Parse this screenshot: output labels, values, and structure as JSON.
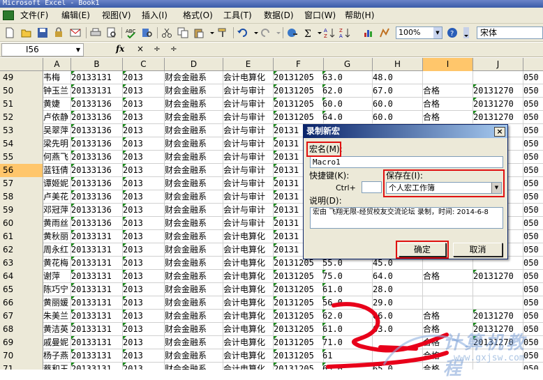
{
  "window": {
    "title": "Microsoft Excel - Book1"
  },
  "menubar": [
    "文件(F)",
    "编辑(E)",
    "视图(V)",
    "插入(I)",
    "格式(O)",
    "工具(T)",
    "数据(D)",
    "窗口(W)",
    "帮助(H)"
  ],
  "toolbar": {
    "zoom": "100%",
    "font": "宋体"
  },
  "formula_bar": {
    "name_box": "I56",
    "fx": "fx",
    "buttons": "× ÷ ÷"
  },
  "columns": [
    "A",
    "B",
    "C",
    "D",
    "E",
    "F",
    "G",
    "H",
    "I",
    "J"
  ],
  "selected_column": "I",
  "selected_row": "56",
  "rows": [
    {
      "n": "49",
      "name": "韦梅",
      "id": "20133131",
      "y": "2013",
      "d": "财会金融系",
      "e": "会计电算化",
      "f": "20131205",
      "g": "63.0",
      "h": "48.0",
      "i": "",
      "j": "",
      "k": "050"
    },
    {
      "n": "50",
      "name": "钟玉兰",
      "id": "20133131",
      "y": "2013",
      "d": "财会金融系",
      "e": "会计与审计",
      "f": "20131205",
      "g": "62.0",
      "h": "67.0",
      "i": "合格",
      "j": "20131270",
      "k": "050"
    },
    {
      "n": "51",
      "name": "黄婕",
      "id": "20133136",
      "y": "2013",
      "d": "财会金融系",
      "e": "会计与审计",
      "f": "20131205",
      "g": "60.0",
      "h": "60.0",
      "i": "合格",
      "j": "20131270",
      "k": "050"
    },
    {
      "n": "52",
      "name": "卢依静",
      "id": "20133136",
      "y": "2013",
      "d": "财会金融系",
      "e": "会计与审计",
      "f": "20131205",
      "g": "64.0",
      "h": "60.0",
      "i": "合格",
      "j": "20131270",
      "k": "050"
    },
    {
      "n": "53",
      "name": "吴翠萍",
      "id": "20133136",
      "y": "2013",
      "d": "财会金融系",
      "e": "会计与审计",
      "f": "20131",
      "g": "",
      "h": "",
      "i": "",
      "j": "",
      "k": "050"
    },
    {
      "n": "54",
      "name": "梁先明",
      "id": "20133136",
      "y": "2013",
      "d": "财会金融系",
      "e": "会计与审计",
      "f": "20131",
      "g": "",
      "h": "",
      "i": "",
      "j": "",
      "k": "050"
    },
    {
      "n": "55",
      "name": "何燕飞",
      "id": "20133136",
      "y": "2013",
      "d": "财会金融系",
      "e": "会计与审计",
      "f": "20131",
      "g": "",
      "h": "",
      "i": "",
      "j": "",
      "k": "050"
    },
    {
      "n": "56",
      "name": "蓝钰倩",
      "id": "20133136",
      "y": "2013",
      "d": "财会金融系",
      "e": "会计与审计",
      "f": "20131",
      "g": "",
      "h": "",
      "i": "",
      "j": "",
      "k": "050"
    },
    {
      "n": "57",
      "name": "谭姬妮",
      "id": "20133136",
      "y": "2013",
      "d": "财会金融系",
      "e": "会计与审计",
      "f": "20131",
      "g": "",
      "h": "",
      "i": "",
      "j": "",
      "k": "050"
    },
    {
      "n": "58",
      "name": "卢美花",
      "id": "20133136",
      "y": "2013",
      "d": "财会金融系",
      "e": "会计与审计",
      "f": "20131",
      "g": "",
      "h": "",
      "i": "",
      "j": "",
      "k": "050"
    },
    {
      "n": "59",
      "name": "邓冠萍",
      "id": "20133136",
      "y": "2013",
      "d": "财会金融系",
      "e": "会计与审计",
      "f": "20131",
      "g": "",
      "h": "",
      "i": "",
      "j": "",
      "k": "050"
    },
    {
      "n": "60",
      "name": "黄雨丝",
      "id": "20133136",
      "y": "2013",
      "d": "财会金融系",
      "e": "会计与审计",
      "f": "20131",
      "g": "",
      "h": "",
      "i": "",
      "j": "",
      "k": "050"
    },
    {
      "n": "61",
      "name": "黄秋丽",
      "id": "20133131",
      "y": "2013",
      "d": "财会金融系",
      "e": "会计电算化",
      "f": "20131",
      "g": "",
      "h": "",
      "i": "",
      "j": "705",
      "k": "050"
    },
    {
      "n": "62",
      "name": "周永红",
      "id": "20133131",
      "y": "2013",
      "d": "财会金融系",
      "e": "会计电算化",
      "f": "20131",
      "g": "",
      "h": "",
      "i": "",
      "j": "705",
      "k": "050"
    },
    {
      "n": "63",
      "name": "黄花梅",
      "id": "20133131",
      "y": "2013",
      "d": "财会金融系",
      "e": "会计电算化",
      "f": "20131205",
      "g": "55.0",
      "h": "45.0",
      "i": "",
      "j": "",
      "k": "050"
    },
    {
      "n": "64",
      "name": "谢萍",
      "id": "20133131",
      "y": "2013",
      "d": "财会金融系",
      "e": "会计电算化",
      "f": "20131205",
      "g": "75.0",
      "h": "64.0",
      "i": "合格",
      "j": "20131270",
      "k": "050"
    },
    {
      "n": "65",
      "name": "陈巧宁",
      "id": "20133131",
      "y": "2013",
      "d": "财会金融系",
      "e": "会计电算化",
      "f": "20131205",
      "g": "61.0",
      "h": "28.0",
      "i": "",
      "j": "",
      "k": "050"
    },
    {
      "n": "66",
      "name": "黄丽媛",
      "id": "20133131",
      "y": "2013",
      "d": "财会金融系",
      "e": "会计电算化",
      "f": "20131205",
      "g": "56.0",
      "h": "29.0",
      "i": "",
      "j": "",
      "k": "050"
    },
    {
      "n": "67",
      "name": "朱美兰",
      "id": "20133131",
      "y": "2013",
      "d": "财会金融系",
      "e": "会计电算化",
      "f": "20131205",
      "g": "62.0",
      "h": "66.0",
      "i": "合格",
      "j": "20131270",
      "k": "050"
    },
    {
      "n": "68",
      "name": "黄洁英",
      "id": "20133131",
      "y": "2013",
      "d": "财会金融系",
      "e": "会计电算化",
      "f": "20131205",
      "g": "61.0",
      "h": "63.0",
      "i": "合格",
      "j": "20131270",
      "k": "050"
    },
    {
      "n": "69",
      "name": "戚曼妮",
      "id": "20133131",
      "y": "2013",
      "d": "财会金融系",
      "e": "会计电算化",
      "f": "20131205",
      "g": "71.0",
      "h": "",
      "i": "合格",
      "j": "20131270",
      "k": "050"
    },
    {
      "n": "70",
      "name": "杨子燕",
      "id": "20133131",
      "y": "2013",
      "d": "财会金融系",
      "e": "会计电算化",
      "f": "20131205",
      "g": "61",
      "h": "",
      "i": "合格",
      "j": "",
      "k": "050"
    },
    {
      "n": "71",
      "name": "蔡和玉",
      "id": "20133131",
      "y": "2013",
      "d": "财会金融系",
      "e": "会计电算化",
      "f": "20131205",
      "g": "63.0",
      "h": "65.0",
      "i": "合格",
      "j": "",
      "k": "050"
    }
  ],
  "dialog": {
    "title": "录制新宏",
    "close": "×",
    "macro_name_label": "宏名(M):",
    "macro_name_value": "Macro1",
    "shortcut_label": "快捷键(K):",
    "ctrl_label": "Ctrl+",
    "shortcut_value": "",
    "store_in_label": "保存在(I):",
    "store_in_value": "个人宏工作簿",
    "description_label": "说明(D):",
    "description_value": "宏由 飞翔无限-经贸校友交流论坛 录制，时间: 2014-6-8",
    "ok_label": "确定",
    "cancel_label": "取消"
  },
  "watermark": {
    "text": "计算机教程",
    "url": "www.gxjsw.com"
  },
  "colors": {
    "highlight": "#e01010",
    "selected_header": "#ffc66b",
    "scribble": "#e8001a"
  }
}
